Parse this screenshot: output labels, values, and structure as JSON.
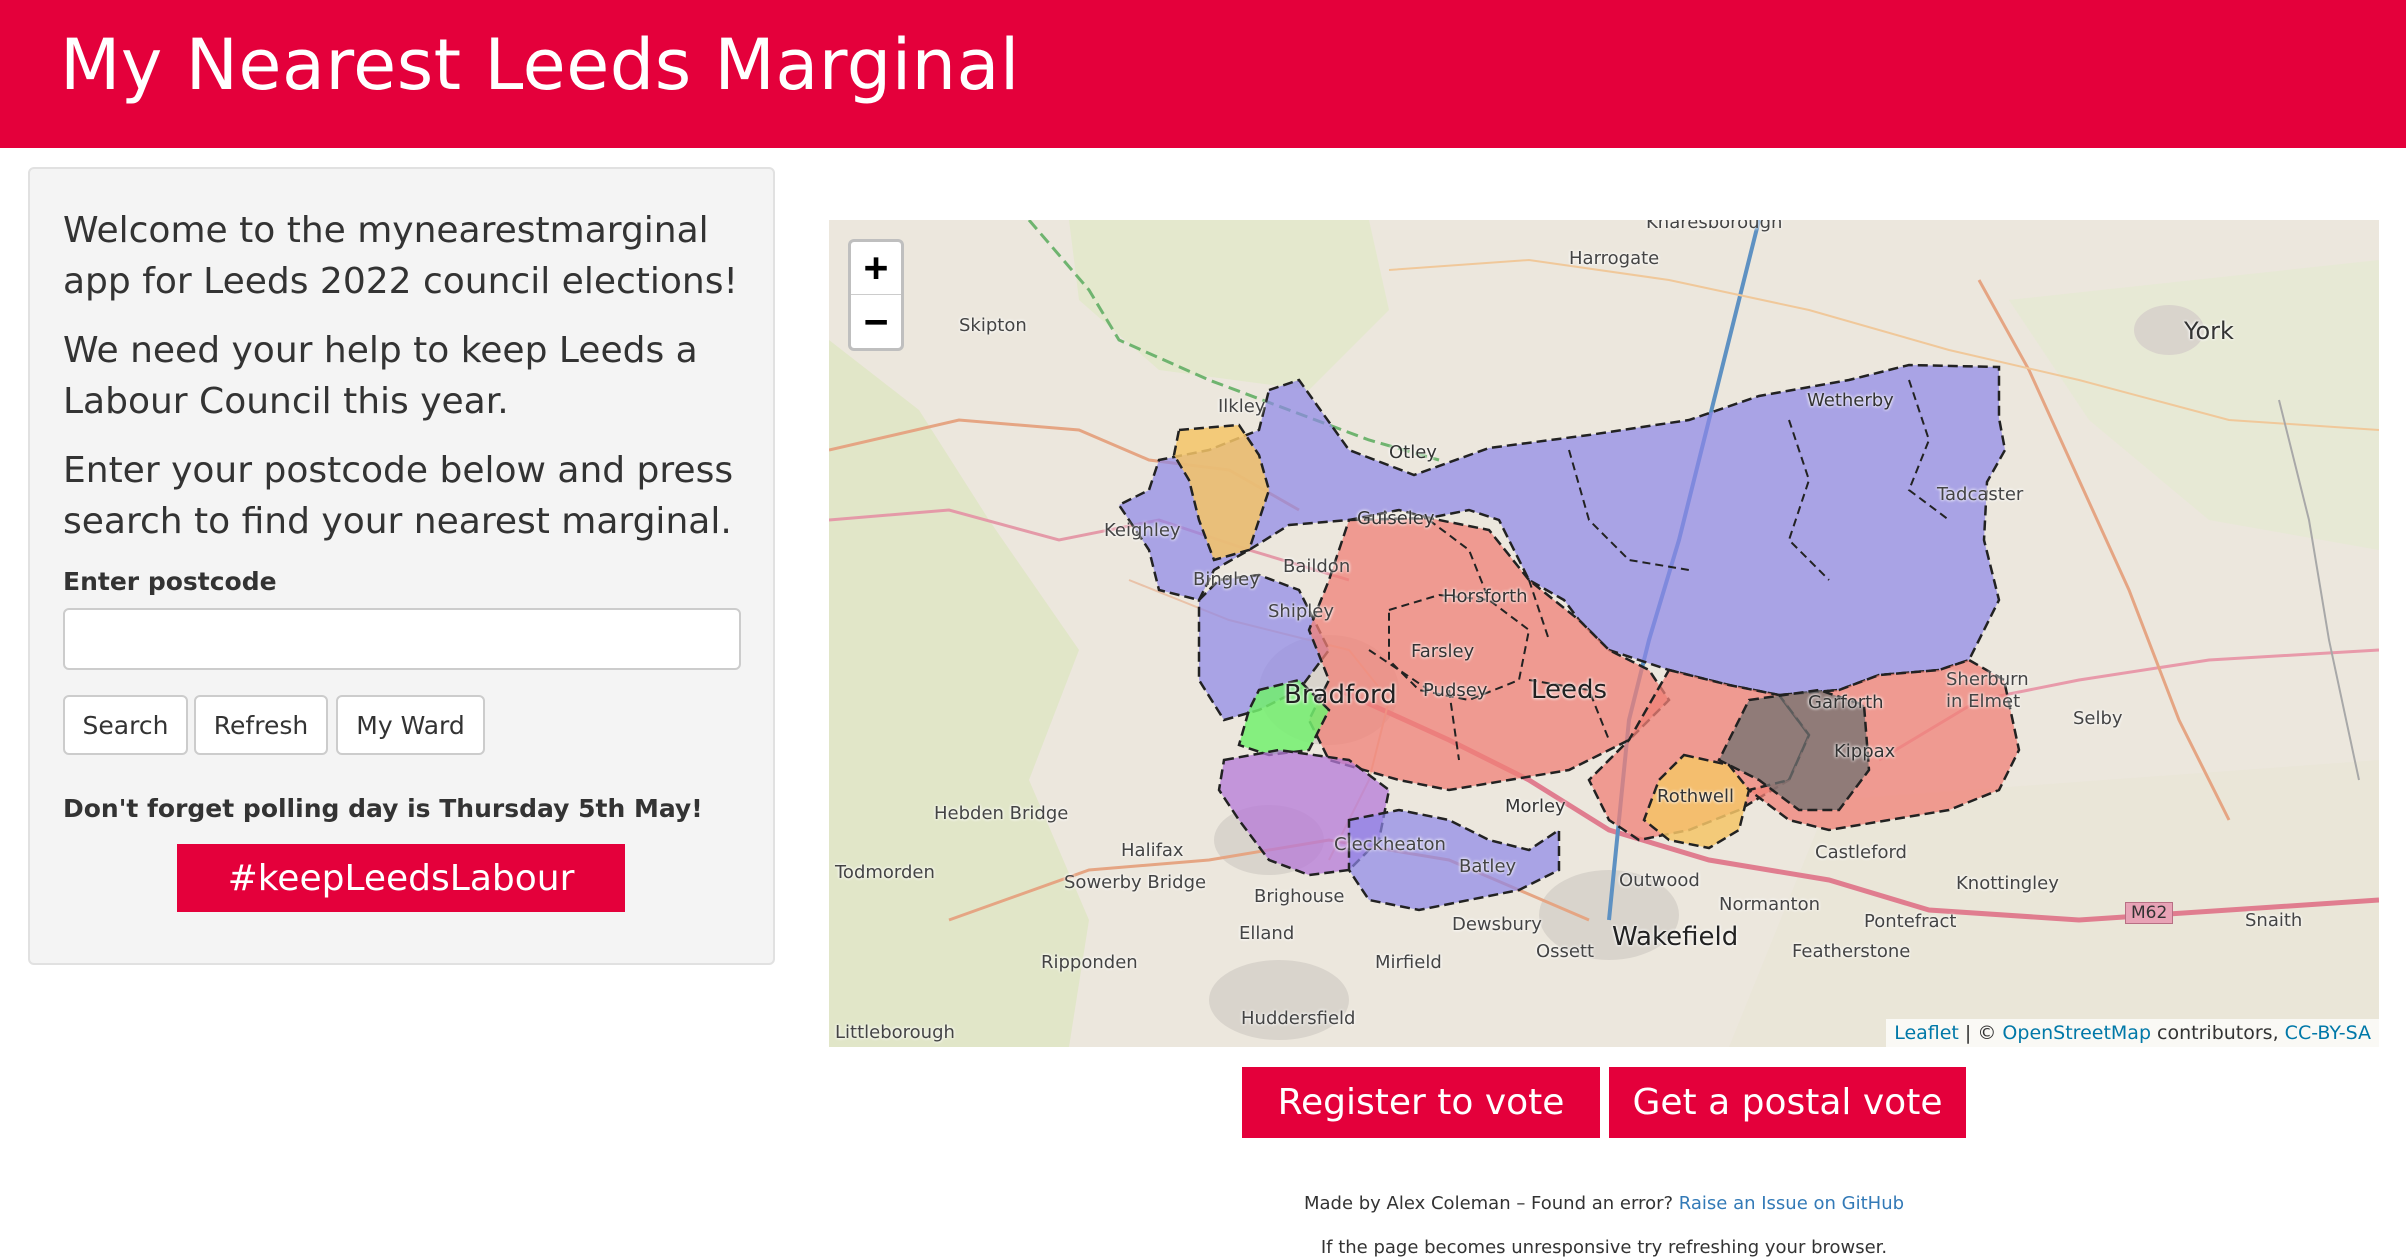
{
  "header": {
    "title": "My Nearest Leeds Marginal"
  },
  "sidebar": {
    "intro": [
      "Welcome to the mynearestmarginal app for Leeds 2022 council elections!",
      "We need your help to keep Leeds a Labour Council this year.",
      "Enter your postcode below and press search to find your nearest marginal."
    ],
    "postcode_label": "Enter postcode",
    "postcode_value": "",
    "buttons": {
      "search": "Search",
      "refresh": "Refresh",
      "my_ward": "My Ward"
    },
    "polling_note": "Don't forget polling day is Thursday 5th May!",
    "hashtag_button": "#keepLeedsLabour"
  },
  "map": {
    "zoom_in": "+",
    "zoom_out": "−",
    "places": {
      "knaresborough": "Knaresborough",
      "harrogate": "Harrogate",
      "skipton": "Skipton",
      "york": "York",
      "ilkley": "Ilkley",
      "wetherby": "Wetherby",
      "otley": "Otley",
      "tadcaster": "Tadcaster",
      "guiseley": "Guiseley",
      "keighley": "Keighley",
      "baildon": "Baildon",
      "bingley": "Bingley",
      "horsforth": "Horsforth",
      "shipley": "Shipley",
      "farsley": "Farsley",
      "sherburn": "Sherburn\nin Elmet",
      "bradford": "Bradford",
      "pudsey": "Pudsey",
      "leeds": "Leeds",
      "garforth": "Garforth",
      "selby": "Selby",
      "kippax": "Kippax",
      "hebden_bridge": "Hebden Bridge",
      "rothwell": "Rothwell",
      "morley": "Morley",
      "halifax": "Halifax",
      "cleckheaton": "Cleckheaton",
      "castleford": "Castleford",
      "todmorden": "Todmorden",
      "batley": "Batley",
      "sowerby_bridge": "Sowerby Bridge",
      "outwood": "Outwood",
      "knottingley": "Knottingley",
      "brighouse": "Brighouse",
      "normanton": "Normanton",
      "m62": "M62",
      "snaith": "Snaith",
      "dewsbury": "Dewsbury",
      "pontefract": "Pontefract",
      "elland": "Elland",
      "wakefield": "Wakefield",
      "ossett": "Ossett",
      "featherstone": "Featherstone",
      "ripponden": "Ripponden",
      "mirfield": "Mirfield",
      "huddersfield": "Huddersfield",
      "littleborough": "Littleborough"
    },
    "attribution": {
      "leaflet": "Leaflet",
      "sep": " | © ",
      "osm": "OpenStreetMap",
      "contrib": " contributors, ",
      "license": "CC-BY-SA"
    },
    "colors": {
      "labour": "#f08077",
      "conservative": "#8d86e8",
      "libdem": "#f5c467",
      "green": "#73f06e",
      "morley_borough": "#b57ad8",
      "independent": "#707070"
    }
  },
  "actions": {
    "register": "Register to vote",
    "postal": "Get a postal vote"
  },
  "footer": {
    "made_by": "Made by Alex Coleman – Found an error? ",
    "issue_link": "Raise an Issue on GitHub",
    "unresponsive": "If the page becomes unresponsive try refreshing your browser."
  }
}
